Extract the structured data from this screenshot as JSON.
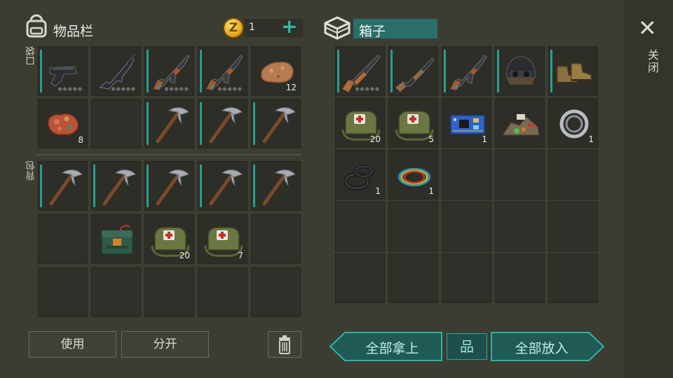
{
  "inventory": {
    "title": "物品栏",
    "pocket_label": "口袋",
    "backpack_label": "背包",
    "coins": "1",
    "coin_symbol": "Z",
    "add_symbol": "+",
    "pocket_slots": [
      {
        "item": "pistol-icon",
        "bar": true,
        "dots": true,
        "qty": ""
      },
      {
        "item": "assault-rifle-icon",
        "bar": false,
        "dots": true,
        "qty": ""
      },
      {
        "item": "ak-rifle-icon",
        "bar": true,
        "dots": true,
        "qty": ""
      },
      {
        "item": "ak-rifle-icon",
        "bar": true,
        "dots": true,
        "qty": ""
      },
      {
        "item": "stone-icon",
        "bar": false,
        "dots": false,
        "qty": "12"
      },
      {
        "item": "copper-ore-icon",
        "bar": false,
        "dots": false,
        "qty": "8"
      },
      {
        "item": "",
        "bar": false,
        "dots": false,
        "qty": ""
      },
      {
        "item": "pickaxe-icon",
        "bar": true,
        "dots": false,
        "qty": ""
      },
      {
        "item": "pickaxe-icon",
        "bar": true,
        "dots": false,
        "qty": ""
      },
      {
        "item": "pickaxe-icon",
        "bar": true,
        "dots": false,
        "qty": ""
      }
    ],
    "backpack_slots": [
      {
        "item": "pickaxe-icon",
        "bar": true,
        "dots": false,
        "qty": ""
      },
      {
        "item": "pickaxe-icon",
        "bar": true,
        "dots": false,
        "qty": ""
      },
      {
        "item": "pickaxe-icon",
        "bar": true,
        "dots": false,
        "qty": ""
      },
      {
        "item": "pickaxe-icon",
        "bar": true,
        "dots": false,
        "qty": ""
      },
      {
        "item": "pickaxe-icon",
        "bar": true,
        "dots": false,
        "qty": ""
      },
      {
        "item": "",
        "bar": false,
        "dots": false,
        "qty": ""
      },
      {
        "item": "explosive-icon",
        "bar": false,
        "dots": false,
        "qty": ""
      },
      {
        "item": "medkit-bag-icon",
        "bar": false,
        "dots": false,
        "qty": "20"
      },
      {
        "item": "medkit-bag-icon",
        "bar": false,
        "dots": false,
        "qty": "7"
      },
      {
        "item": "",
        "bar": false,
        "dots": false,
        "qty": ""
      },
      {
        "item": "",
        "bar": false,
        "dots": false,
        "qty": ""
      },
      {
        "item": "",
        "bar": false,
        "dots": false,
        "qty": ""
      },
      {
        "item": "",
        "bar": false,
        "dots": false,
        "qty": ""
      },
      {
        "item": "",
        "bar": false,
        "dots": false,
        "qty": ""
      },
      {
        "item": "",
        "bar": false,
        "dots": false,
        "qty": ""
      }
    ],
    "use_button": "使用",
    "split_button": "分开"
  },
  "box": {
    "title": "箱子",
    "slots": [
      {
        "item": "hunting-rifle-icon",
        "bar": true,
        "dots": true,
        "qty": ""
      },
      {
        "item": "shotgun-icon",
        "bar": true,
        "dots": false,
        "qty": ""
      },
      {
        "item": "ak-rifle-icon",
        "bar": true,
        "dots": false,
        "qty": ""
      },
      {
        "item": "helmet-icon",
        "bar": true,
        "dots": false,
        "qty": ""
      },
      {
        "item": "boots-icon",
        "bar": true,
        "dots": false,
        "qty": ""
      },
      {
        "item": "medkit-bag-icon",
        "bar": false,
        "dots": false,
        "qty": "20"
      },
      {
        "item": "medkit-bag-icon",
        "bar": false,
        "dots": false,
        "qty": "5"
      },
      {
        "item": "circuit-board-icon",
        "bar": false,
        "dots": false,
        "qty": "1"
      },
      {
        "item": "scrap-pile-icon",
        "bar": false,
        "dots": false,
        "qty": ""
      },
      {
        "item": "bearing-icon",
        "bar": false,
        "dots": false,
        "qty": "1"
      },
      {
        "item": "rubber-rings-icon",
        "bar": false,
        "dots": false,
        "qty": "1"
      },
      {
        "item": "wires-icon",
        "bar": false,
        "dots": false,
        "qty": "1"
      }
    ],
    "take_all_button": "全部拿上",
    "put_all_button": "全部放入",
    "sort_symbol": "品"
  },
  "close_label": "关闭",
  "close_symbol": "✕",
  "colors": {
    "accent": "#2a9d8f",
    "panel": "#3b3d33",
    "slot": "#2c2e27",
    "title_bg": "#2a6f6a"
  }
}
